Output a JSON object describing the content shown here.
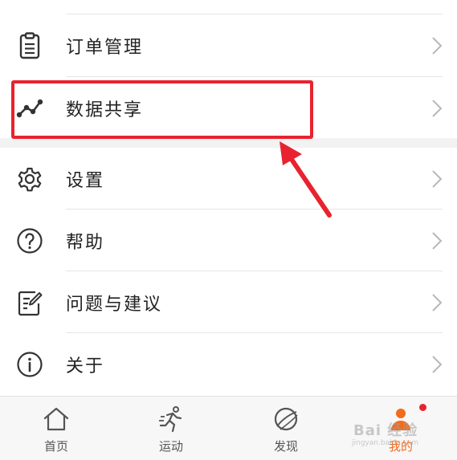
{
  "menu_groups": [
    {
      "items": [
        {
          "label": "订单管理",
          "icon": "clipboard-icon"
        },
        {
          "label": "数据共享",
          "icon": "trend-line-icon"
        }
      ]
    },
    {
      "items": [
        {
          "label": "设置",
          "icon": "gear-icon"
        },
        {
          "label": "帮助",
          "icon": "help-circle-icon"
        },
        {
          "label": "问题与建议",
          "icon": "edit-note-icon"
        },
        {
          "label": "关于",
          "icon": "info-circle-icon"
        }
      ]
    }
  ],
  "annotation": {
    "highlighted_item": "数据共享",
    "color": "#e8232f"
  },
  "tabbar": {
    "tabs": [
      {
        "label": "首页",
        "icon": "home-icon",
        "active": false
      },
      {
        "label": "运动",
        "icon": "running-icon",
        "active": false
      },
      {
        "label": "发现",
        "icon": "planet-icon",
        "active": false
      },
      {
        "label": "我的",
        "icon": "profile-icon",
        "active": true
      }
    ],
    "active_color": "#f26a1b",
    "notification_dot_color": "#e8232f"
  },
  "watermark": {
    "text": "Bai 经验",
    "sub": "jingyan.baidu.com"
  }
}
